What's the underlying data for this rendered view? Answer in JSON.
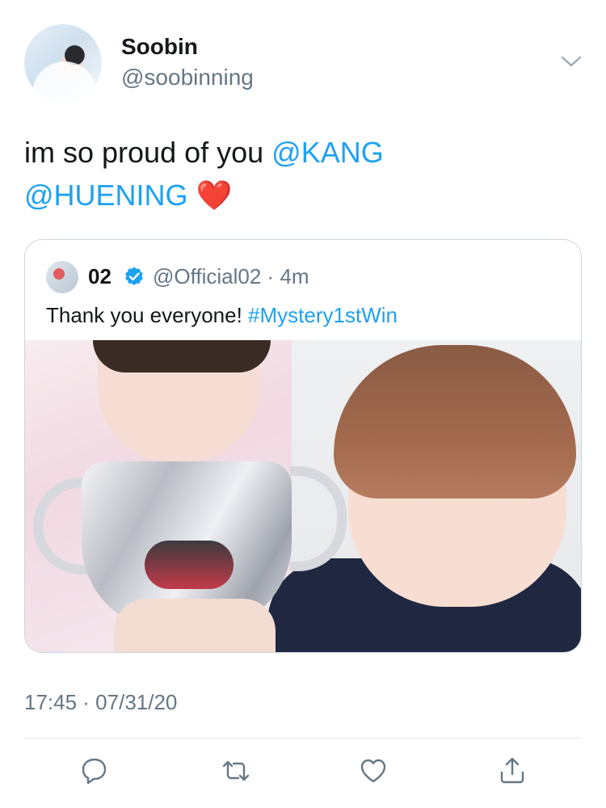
{
  "author": {
    "display_name": "Soobin",
    "handle": "@soobinning"
  },
  "tweet": {
    "text_plain": "im so proud of you ",
    "mention_1": "@KANG",
    "mention_2": "@HUENING",
    "emoji": "❤️"
  },
  "quoted_tweet": {
    "display_name": "02",
    "handle": "@Official02",
    "separator": "·",
    "age": "4m",
    "text_plain": "Thank you everyone! ",
    "hashtag": "#Mystery1stWin"
  },
  "timestamp": "17:45 · 07/31/20",
  "icons": {
    "menu": "chevron-down-icon",
    "verified": "verified-badge-icon",
    "reply": "reply-icon",
    "retweet": "retweet-icon",
    "like": "heart-icon",
    "share": "share-icon"
  },
  "colors": {
    "accent": "#1da1f2",
    "muted": "#657786",
    "text": "#14171a",
    "border": "#ccd6dd",
    "heart": "#e0245e"
  }
}
